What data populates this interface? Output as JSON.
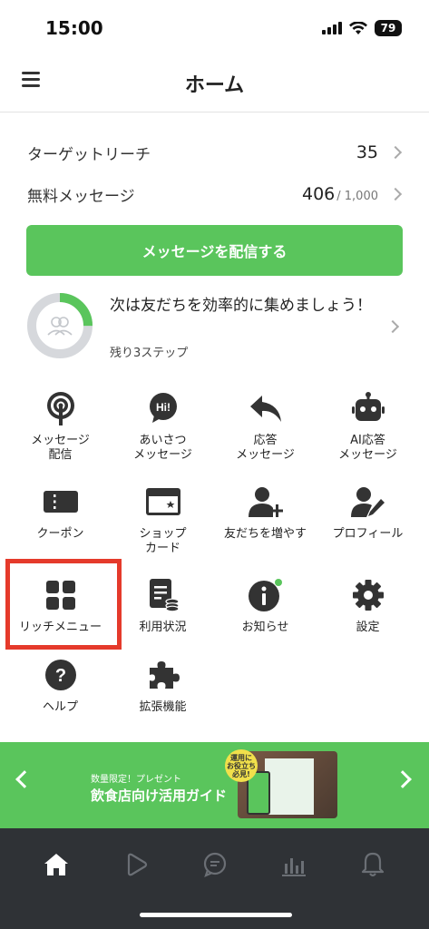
{
  "status": {
    "time": "15:00",
    "battery": "79"
  },
  "header": {
    "title": "ホーム"
  },
  "stats": {
    "target_reach": {
      "label": "ターゲットリーチ",
      "value": "35"
    },
    "free_messages": {
      "label": "無料メッセージ",
      "value": "406",
      "limit": "/ 1,000"
    }
  },
  "broadcast": {
    "label": "メッセージを配信する"
  },
  "progress": {
    "title": "次は友だちを効率的に集めましょう！",
    "subtitle": "残り3ステップ",
    "fraction": 0.25,
    "accent": "#5ac55c"
  },
  "menu": {
    "items": [
      {
        "label": "メッセージ\n配信",
        "icon": "broadcast-icon"
      },
      {
        "label": "あいさつ\nメッセージ",
        "icon": "greeting-icon",
        "icon_text": "Hi!"
      },
      {
        "label": "応答\nメッセージ",
        "icon": "reply-icon"
      },
      {
        "label": "AI応答\nメッセージ",
        "icon": "robot-icon"
      },
      {
        "label": "クーポン",
        "icon": "coupon-icon"
      },
      {
        "label": "ショップ\nカード",
        "icon": "shop-card-icon"
      },
      {
        "label": "友だちを増やす",
        "icon": "add-friend-icon"
      },
      {
        "label": "プロフィール",
        "icon": "profile-edit-icon"
      },
      {
        "label": "リッチメニュー",
        "icon": "rich-menu-icon"
      },
      {
        "label": "利用状況",
        "icon": "usage-icon"
      },
      {
        "label": "お知らせ",
        "icon": "info-icon"
      },
      {
        "label": "設定",
        "icon": "gear-icon"
      },
      {
        "label": "ヘルプ",
        "icon": "help-icon"
      },
      {
        "label": "拡張機能",
        "icon": "puzzle-icon"
      }
    ]
  },
  "banner": {
    "small": "数量限定！プレゼント",
    "main": "飲食店向け活用ガイド",
    "badge": "運用に\nお役立ち\n必見!",
    "color": "#5ac55c"
  },
  "tabbar": {
    "tabs": [
      "home-icon",
      "play-icon",
      "chat-icon",
      "chart-icon",
      "bell-icon"
    ],
    "background": "#2f3236"
  },
  "colors": {
    "accent": "#5ac55c",
    "highlight": "#e53a2b"
  }
}
